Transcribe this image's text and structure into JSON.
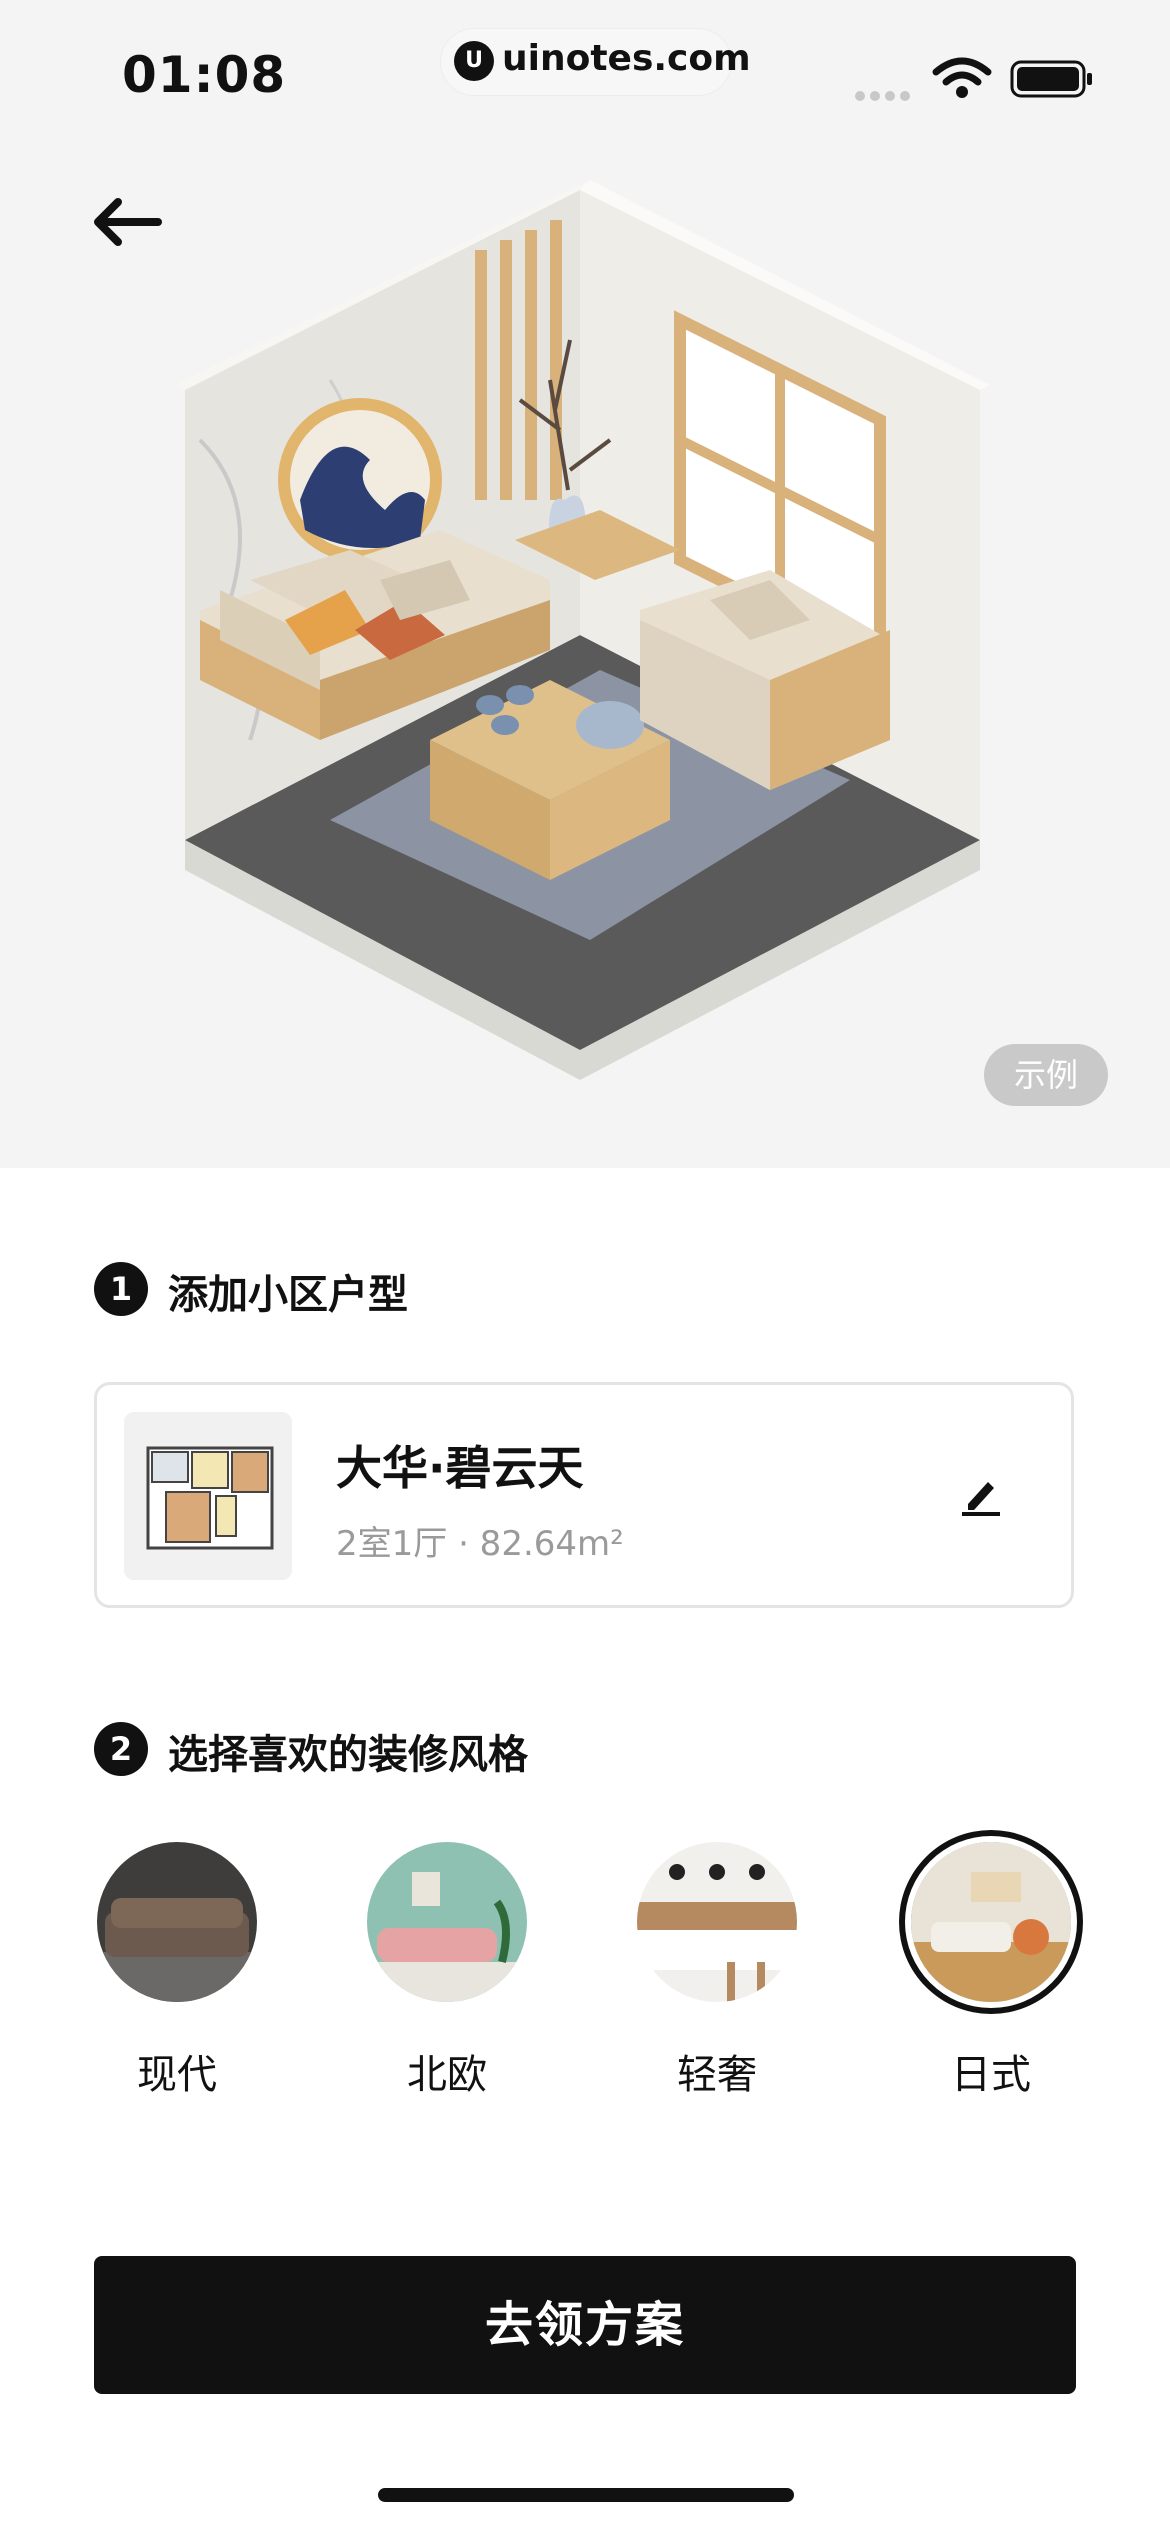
{
  "status_bar": {
    "time": "01:08",
    "url": "uinotes.com"
  },
  "hero": {
    "sample_badge": "示例"
  },
  "step1": {
    "number": "1",
    "title": "添加小区户型",
    "card": {
      "name": "大华·碧云天",
      "spec": "2室1厅 · 82.64m²"
    }
  },
  "step2": {
    "number": "2",
    "title": "选择喜欢的装修风格",
    "styles": [
      {
        "label": "现代",
        "selected": false
      },
      {
        "label": "北欧",
        "selected": false
      },
      {
        "label": "轻奢",
        "selected": false
      },
      {
        "label": "日式",
        "selected": true
      }
    ]
  },
  "cta": {
    "label": "去领方案"
  },
  "colors": {
    "primary": "#111111",
    "hero_bg": "#f4f4f4",
    "muted_text": "#9a9a9a",
    "badge_bg": "#c9c9c9"
  }
}
